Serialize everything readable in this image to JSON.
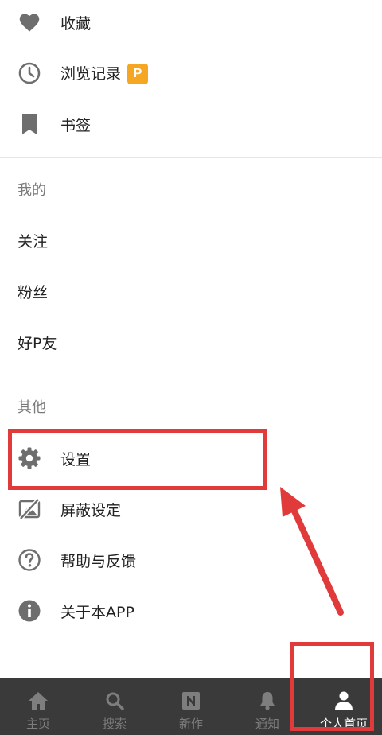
{
  "menu_top": [
    {
      "label": "收藏",
      "icon": "heart-icon"
    },
    {
      "label": "浏览记录",
      "icon": "clock-icon",
      "badge": "P"
    },
    {
      "label": "书签",
      "icon": "bookmark-icon"
    }
  ],
  "section_mine": {
    "title": "我的",
    "items": [
      {
        "label": "关注"
      },
      {
        "label": "粉丝"
      },
      {
        "label": "好P友"
      }
    ]
  },
  "section_other": {
    "title": "其他",
    "items": [
      {
        "label": "设置",
        "icon": "gear-icon"
      },
      {
        "label": "屏蔽设定",
        "icon": "mute-image-icon"
      },
      {
        "label": "帮助与反馈",
        "icon": "help-circle-icon"
      },
      {
        "label": "关于本APP",
        "icon": "info-circle-icon"
      }
    ]
  },
  "tabbar": {
    "tabs": [
      {
        "label": "主页",
        "icon": "home-icon"
      },
      {
        "label": "搜索",
        "icon": "search-icon"
      },
      {
        "label": "新作",
        "icon": "new-works-icon"
      },
      {
        "label": "通知",
        "icon": "bell-icon"
      },
      {
        "label": "个人首页",
        "icon": "person-icon",
        "active": true
      }
    ]
  },
  "colors": {
    "accent_badge": "#f5a623",
    "annotation_red": "#e03a3a",
    "tabbar_bg": "#3a3a3a"
  }
}
